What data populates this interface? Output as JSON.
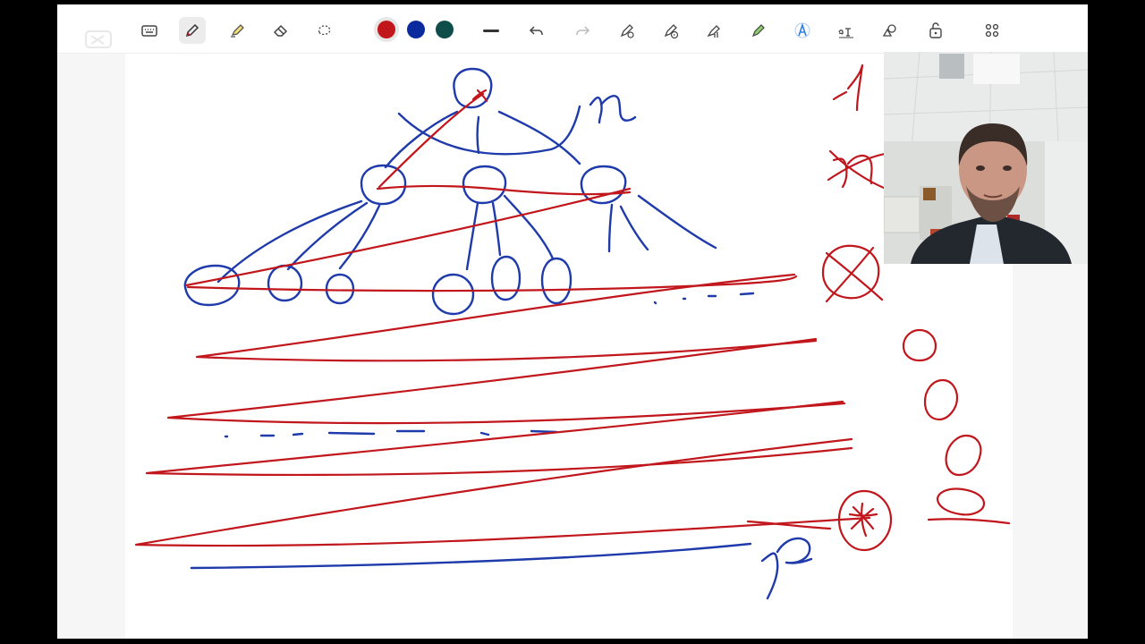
{
  "toolbar": {
    "tools": [
      {
        "name": "keyboard-icon"
      },
      {
        "name": "pen-icon",
        "active": true
      },
      {
        "name": "highlighter-icon"
      },
      {
        "name": "eraser-icon"
      },
      {
        "name": "lasso-icon"
      }
    ],
    "colors": [
      "#c0161c",
      "#0a2a9e",
      "#0f4d4a"
    ],
    "selected_color": "#c0161c",
    "actions": [
      {
        "name": "line-thickness-icon"
      },
      {
        "name": "undo-icon"
      },
      {
        "name": "redo-icon"
      },
      {
        "name": "ink-to-shape-icon"
      },
      {
        "name": "ink-replay-icon"
      },
      {
        "name": "ink-ruler-icon"
      },
      {
        "name": "pen-settings-icon"
      },
      {
        "name": "ink-to-text-icon"
      },
      {
        "name": "text-ink-icon"
      },
      {
        "name": "shapes-icon"
      },
      {
        "name": "lock-icon"
      },
      {
        "name": "apps-grid-icon"
      }
    ]
  },
  "canvas": {
    "handwritten_labels": [
      "n",
      "1",
      "p"
    ],
    "ink_colors": {
      "red": "#c0161c",
      "blue": "#1f3bab"
    }
  },
  "webcam": {
    "visible": true
  }
}
